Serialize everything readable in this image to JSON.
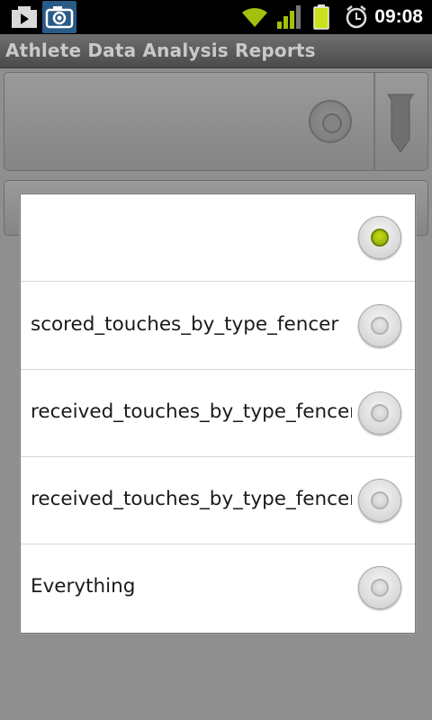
{
  "status_bar": {
    "time": "09:08",
    "icons": [
      "media-play-icon",
      "camera-icon",
      "wifi-icon",
      "signal-icon",
      "battery-icon",
      "alarm-icon"
    ]
  },
  "title_bar": {
    "title": "Athlete Data Analysis Reports"
  },
  "dialog": {
    "options": [
      {
        "label": "",
        "checked": true
      },
      {
        "label": "scored_touches_by_type_fencer",
        "checked": false
      },
      {
        "label": "received_touches_by_type_fencer",
        "checked": false
      },
      {
        "label": "received_touches_by_type_fencer",
        "checked": false
      },
      {
        "label": "Everything",
        "checked": false
      }
    ]
  },
  "colors": {
    "accent_radio": "#a4c00d",
    "wifi": "#a4c00d",
    "battery": "#c9e11b"
  }
}
